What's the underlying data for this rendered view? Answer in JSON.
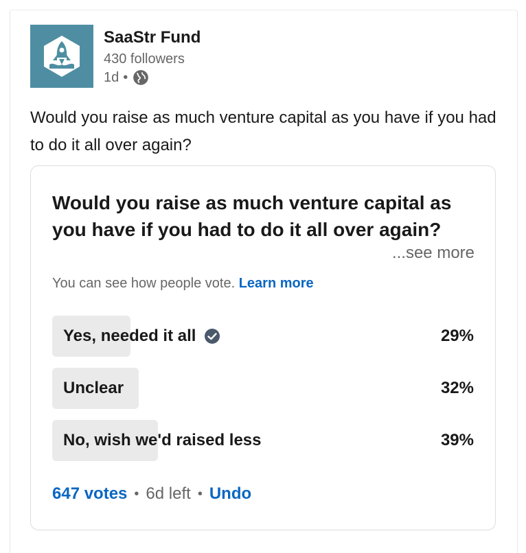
{
  "post": {
    "author": "SaaStr Fund",
    "followers": "430 followers",
    "age": "1d",
    "dot": "•",
    "visibility_icon": "globe-icon",
    "text": "Would you raise as much venture capital as you have if you had to do it all over again?"
  },
  "poll": {
    "question": "Would you raise as much venture capital as you have if you had to do it all over again?",
    "see_more": "...see more",
    "visibility_note": "You can see how people vote.",
    "learn_more": "Learn more",
    "options": [
      {
        "label": "Yes, needed it all",
        "percent": "29%",
        "value": 29,
        "selected": true
      },
      {
        "label": "Unclear",
        "percent": "32%",
        "value": 32,
        "selected": false
      },
      {
        "label": "No, wish we'd raised less",
        "percent": "39%",
        "value": 39,
        "selected": false
      }
    ],
    "votes": "647 votes",
    "time_left": "6d left",
    "sep": "•",
    "undo": "Undo"
  },
  "colors": {
    "logo_bg": "#4f8ea2",
    "link": "#0a66c2",
    "bar_fill": "#eaeaea",
    "check": "#4a5a6a"
  }
}
